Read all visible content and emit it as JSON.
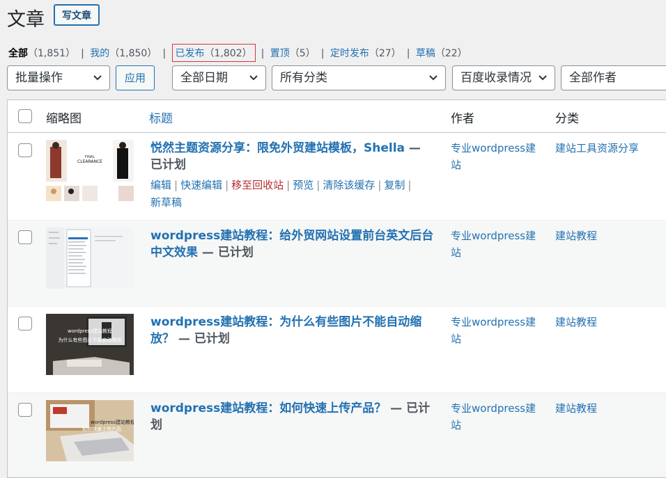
{
  "header": {
    "title": "文章",
    "add_new": "写文章"
  },
  "views": [
    {
      "label": "全部",
      "count": "（1,851）"
    },
    {
      "label": "我的",
      "count": "（1,850）"
    },
    {
      "label": "已发布",
      "count": "（1,802）"
    },
    {
      "label": "置顶",
      "count": "（5）"
    },
    {
      "label": "定时发布",
      "count": "（27）"
    },
    {
      "label": "草稿",
      "count": "（22）"
    }
  ],
  "filters": {
    "bulk_action": "批量操作",
    "apply": "应用",
    "date": "全部日期",
    "category": "所有分类",
    "baidu": "百度收录情况",
    "author": "全部作者"
  },
  "columns": {
    "thumb": "缩略图",
    "title": "标题",
    "author": "作者",
    "category": "分类"
  },
  "rows": [
    {
      "title": "悦然主题资源分享：限免外贸建站模板，Shella",
      "state": " — 已计划",
      "author": "专业wordpress建站",
      "category": "建站工具资源分享",
      "actions": [
        "编辑",
        "快速编辑",
        "移至回收站",
        "预览",
        "清除该缓存",
        "复制",
        "新草稿"
      ],
      "thumb_text": "FINAL CLEARANCE"
    },
    {
      "title": "wordpress建站教程：给外贸网站设置前台英文后台中文效果",
      "state": " — 已计划",
      "author": "专业wordpress建站",
      "category": "建站教程"
    },
    {
      "title": "wordpress建站教程：为什么有些图片不能自动缩放？",
      "state": " — 已计划",
      "author": "专业wordpress建站",
      "category": "建站教程",
      "thumb_text": "wordpress建站教程",
      "thumb_text2": "为什么有些图片不能自动缩放"
    },
    {
      "title": "wordpress建站教程：如何快速上传产品？",
      "state": " — 已计划",
      "author": "专业wordpress建站",
      "category": "建站教程",
      "thumb_text": "wordpress建站教程",
      "thumb_text2": "如何快速上传产品"
    }
  ],
  "colors": {
    "link": "#2271b1",
    "trash": "#b32d2e",
    "highlight_border": "#d63638"
  }
}
